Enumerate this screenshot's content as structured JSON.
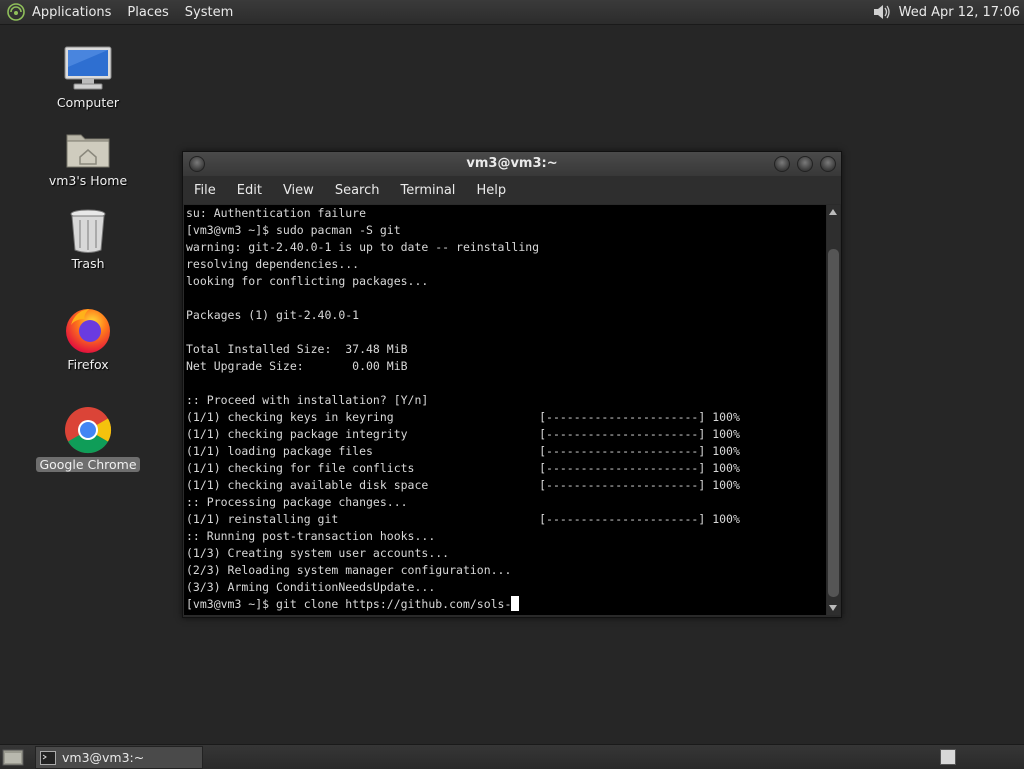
{
  "top_panel": {
    "menus": [
      "Applications",
      "Places",
      "System"
    ],
    "clock": "Wed Apr 12, 17:06"
  },
  "desktop": {
    "icons": [
      {
        "label": "Computer",
        "icon": "computer-icon"
      },
      {
        "label": "vm3's Home",
        "icon": "home-folder-icon"
      },
      {
        "label": "Trash",
        "icon": "trash-icon"
      },
      {
        "label": "Firefox",
        "icon": "firefox-icon"
      },
      {
        "label": "Google Chrome",
        "icon": "chrome-icon"
      }
    ]
  },
  "window": {
    "title": "vm3@vm3:~",
    "menu": [
      "File",
      "Edit",
      "View",
      "Search",
      "Terminal",
      "Help"
    ]
  },
  "terminal": {
    "lines": [
      "su: Authentication failure",
      "[vm3@vm3 ~]$ sudo pacman -S git",
      "warning: git-2.40.0-1 is up to date -- reinstalling",
      "resolving dependencies...",
      "looking for conflicting packages...",
      "",
      "Packages (1) git-2.40.0-1",
      "",
      "Total Installed Size:  37.48 MiB",
      "Net Upgrade Size:       0.00 MiB",
      "",
      ":: Proceed with installation? [Y/n]",
      "(1/1) checking keys in keyring                     [----------------------] 100%",
      "(1/1) checking package integrity                   [----------------------] 100%",
      "(1/1) loading package files                        [----------------------] 100%",
      "(1/1) checking for file conflicts                  [----------------------] 100%",
      "(1/1) checking available disk space                [----------------------] 100%",
      ":: Processing package changes...",
      "(1/1) reinstalling git                             [----------------------] 100%",
      ":: Running post-transaction hooks...",
      "(1/3) Creating system user accounts...",
      "(2/3) Reloading system manager configuration...",
      "(3/3) Arming ConditionNeedsUpdate..."
    ],
    "prompt_line": "[vm3@vm3 ~]$ git clone https://github.com/sols-"
  },
  "taskbar": {
    "task_label": "vm3@vm3:~"
  }
}
